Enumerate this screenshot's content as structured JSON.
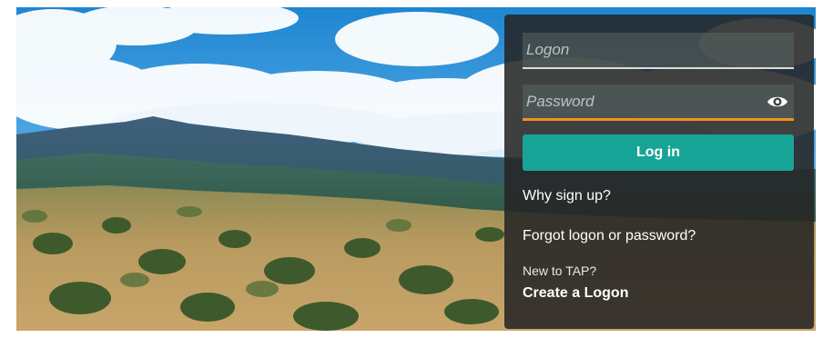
{
  "login": {
    "logon_placeholder": "Logon",
    "password_placeholder": "Password",
    "show_password_icon": "eye-icon",
    "login_label": "Log in",
    "why_signup_label": "Why sign up?",
    "forgot_label": "Forgot logon or password?",
    "new_to_text": "New to TAP?",
    "create_label": "Create a Logon"
  },
  "colors": {
    "accent": "#17a497",
    "password_underline": "#f0941a",
    "panel": "#262626"
  }
}
